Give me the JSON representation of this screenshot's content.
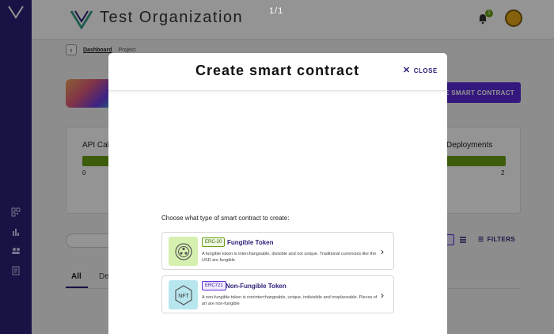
{
  "app": {
    "organization_title": "Test Organization",
    "notification_count": "1",
    "page_counter": "1/1"
  },
  "breadcrumb": {
    "dashboard": "Dashboard",
    "current": "Project"
  },
  "page": {
    "create_button": "TE SMART CONTRACT",
    "stat_left": {
      "label": "API Cal",
      "min": "0"
    },
    "stat_right": {
      "label": "Deployments",
      "max": "2"
    },
    "filters_label": "FILTERS",
    "tabs": [
      "All",
      "De"
    ]
  },
  "modal": {
    "title": "Create smart contract",
    "close_label": "CLOSE",
    "prompt": "Choose what type of smart contract to create:",
    "options": [
      {
        "badge": "ERC-20",
        "title": "Fungible Token",
        "description": "A fungible token is interchangeable, divisible and not unique. Traditional currencies like the USD are fungible",
        "icon": "fungible-token-icon",
        "color": "#d6f0b0"
      },
      {
        "badge": "ERC721",
        "title": "Non-Fungible Token",
        "description": "A non-fungible token is noninterchangeable, unique, indivisible and irreplaceable. Pieces of art are non-fungible",
        "icon": "nft-icon",
        "icon_text": "NFT",
        "color": "#b8e6ef"
      }
    ]
  },
  "colors": {
    "sidebar": "#2a1f78",
    "accent": "#5a2ad8",
    "progress": "#6aa014"
  }
}
